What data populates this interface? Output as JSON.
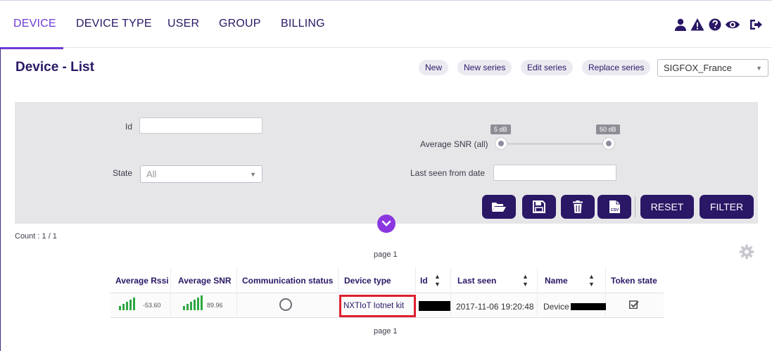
{
  "nav": {
    "items": [
      {
        "label": "DEVICE",
        "active": true
      },
      {
        "label": "DEVICE TYPE",
        "active": false
      },
      {
        "label": "USER",
        "active": false
      },
      {
        "label": "GROUP",
        "active": false
      },
      {
        "label": "BILLING",
        "active": false
      }
    ],
    "icons": [
      "user-icon",
      "warning-icon",
      "help-icon",
      "eye-icon",
      "logout-icon"
    ],
    "accent": "#6e3ad6",
    "text_color": "#2a1766"
  },
  "title": "Device - List",
  "actions": [
    "New",
    "New series",
    "Edit series",
    "Replace series"
  ],
  "group_select": {
    "value": "SIGFOX_France"
  },
  "filters": {
    "id_label": "Id",
    "id_value": "",
    "state_label": "State",
    "state_value": "All",
    "snr_label": "Average SNR (all)",
    "snr_min": "5 dB",
    "snr_max": "50 dB",
    "last_seen_label": "Last seen from date",
    "last_seen_value": "",
    "icon_buttons": [
      "folder-open-icon",
      "save-icon",
      "trash-icon",
      "csv-icon"
    ],
    "reset_label": "RESET",
    "filter_label": "FILTER"
  },
  "count": "Count : 1 / 1",
  "pager_top": "page 1",
  "pager_bottom": "page 1",
  "table": {
    "headers": [
      "Average Rssi",
      "Average SNR",
      "Communication status",
      "Device type",
      "Id",
      "Last seen",
      "Name",
      "Token state"
    ],
    "rows": [
      {
        "rssi": "-53.60",
        "snr": "89.96",
        "device_type": "NXTIoT Iotnet kit",
        "id": "",
        "last_seen": "2017-11-06 19:20:48",
        "name": "Device",
        "token_state": true
      }
    ]
  },
  "colors": {
    "primary_button": "#2a1766",
    "signal_green": "#2ea843",
    "highlight": "#e01f2d",
    "collapse_button": "#8a37e0",
    "panel_bg": "#e6e6e8"
  }
}
